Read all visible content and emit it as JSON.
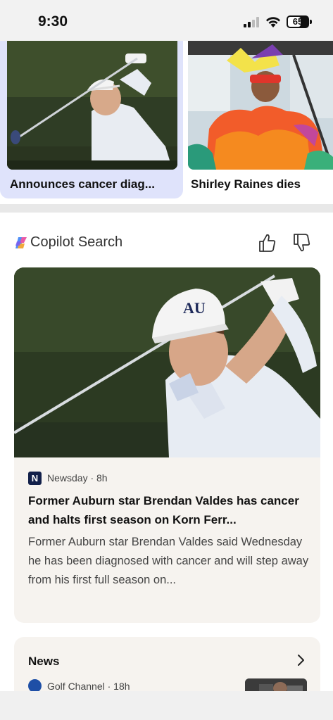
{
  "status_bar": {
    "time": "9:30",
    "battery": "65"
  },
  "carousel": {
    "cards": [
      {
        "caption": "Announces cancer diag...",
        "image": "golfer-swing-photo"
      },
      {
        "caption": "Shirley Raines dies",
        "image": "colorful-costume-person-photo"
      }
    ]
  },
  "copilot": {
    "title": "Copilot Search",
    "thumbs_up_icon": "thumbs-up-icon",
    "thumbs_down_icon": "thumbs-down-icon",
    "article": {
      "source_logo": "N",
      "source": "Newsday · 8h",
      "headline": "Former Auburn star Brendan Valdes has cancer and halts first season on Korn Ferr...",
      "snippet": "Former Auburn star Brendan Valdes said Wednesday he has been diagnosed with cancer and will step away from his first full season on..."
    },
    "news": {
      "title": "News",
      "source": "Golf Channel · 18h"
    }
  },
  "colors": {
    "selected_card_bg": "#dfe3fb",
    "card_bg": "#f6f3ef",
    "newsday_logo": "#12204a"
  }
}
